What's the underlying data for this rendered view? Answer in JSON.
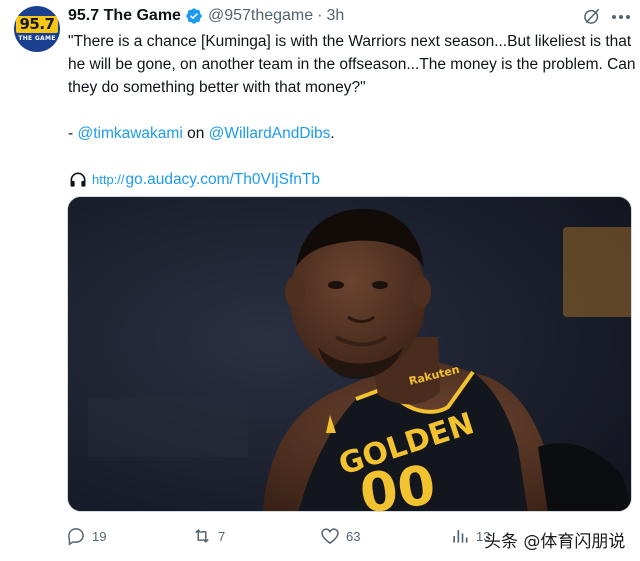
{
  "account": {
    "avatar_logo_number": "95.7",
    "avatar_logo_text": "THE GAME",
    "display_name": "95.7 The Game",
    "handle": "@957thegame",
    "separator": "·",
    "timestamp": "3h"
  },
  "tweet": {
    "quote": "\"There is a chance [Kuminga] is with the Warriors next season...But likeliest is that he will be gone, on another team in the offseason...The money is the problem. Can they do something better with that money?\"",
    "credit_dash": "- ",
    "credit_handle_1": "@timkawakami",
    "credit_on": " on ",
    "credit_handle_2": "@WillardAndDibs",
    "credit_period": ".",
    "link_prefix": "http://",
    "link_text": "go.audacy.com/Th0VIjSfnTb"
  },
  "media": {
    "jersey_sponsor": "Rakuten",
    "jersey_text": "GOLDEN",
    "jersey_number": "00"
  },
  "actions": {
    "replies": "19",
    "retweets": "7",
    "likes": "63",
    "views": "13"
  },
  "watermark": "头条 @体育闪朋说",
  "colors": {
    "link": "#1d9bf0",
    "verified": "#1d9bf0",
    "muted": "#536471",
    "jersey_gold": "#f2c230"
  }
}
